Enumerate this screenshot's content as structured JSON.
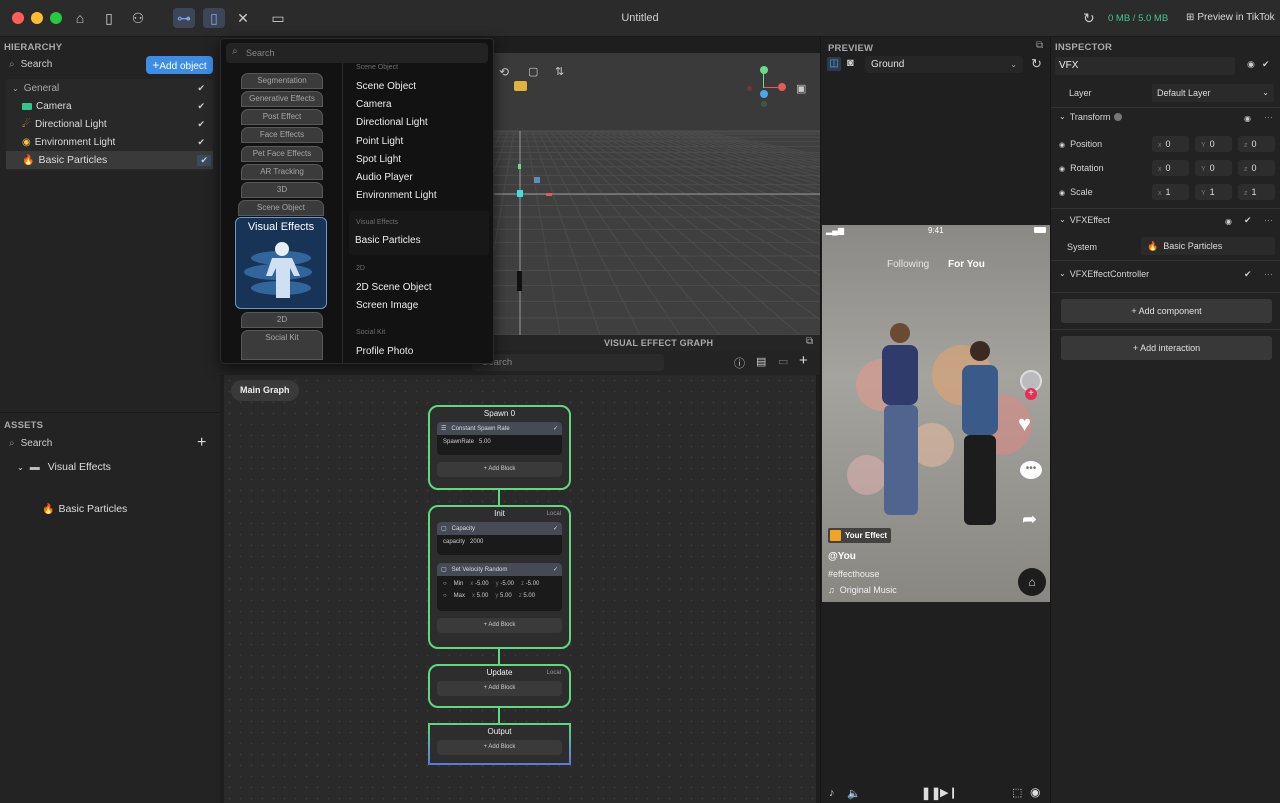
{
  "window": {
    "title": "Untitled",
    "storage": "0 MB / 5.0 MB",
    "preview_tiktok": "Preview in TikTok",
    "storage_color": "#3ec98b"
  },
  "toolbar": {
    "icons": [
      "home-icon",
      "book-icon",
      "nodes-icon",
      "graph-icon",
      "phone-icon",
      "tools-icon",
      "tablet-icon"
    ]
  },
  "hierarchy": {
    "title": "HIERARCHY",
    "search_placeholder": "Search",
    "add_object": "Add object",
    "items": [
      {
        "label": "General",
        "type": "group"
      },
      {
        "label": "Camera",
        "type": "camera"
      },
      {
        "label": "Directional Light",
        "type": "light"
      },
      {
        "label": "Environment Light",
        "type": "envlight"
      },
      {
        "label": "Basic Particles",
        "type": "particles",
        "selected": true
      }
    ]
  },
  "assets": {
    "title": "ASSETS",
    "search_placeholder": "Search",
    "items": [
      {
        "label": "Visual Effects",
        "type": "folder"
      },
      {
        "label": "Basic Particles",
        "type": "particles"
      }
    ]
  },
  "add_menu": {
    "search_placeholder": "Search",
    "categories": [
      "Segmentation",
      "Generative Effects",
      "Post Effect",
      "Face Effects",
      "Pet Face Effects",
      "AR Tracking",
      "3D",
      "Scene Object",
      "Visual Effects",
      "2D",
      "Social Kit"
    ],
    "selected_category": "Visual Effects",
    "sections": [
      {
        "title": "Scene Object",
        "items": [
          "Scene Object",
          "Camera",
          "Directional Light",
          "Point Light",
          "Spot Light",
          "Audio Player",
          "Environment Light"
        ]
      },
      {
        "title": "Visual Effects",
        "items": [
          "Basic Particles"
        ]
      },
      {
        "title": "2D",
        "items": [
          "2D Scene Object",
          "Screen Image"
        ]
      },
      {
        "title": "Social Kit",
        "items": [
          "Profile Photo"
        ]
      }
    ]
  },
  "graph": {
    "title": "VISUAL EFFECT GRAPH",
    "search_placeholder": "Search",
    "breadcrumb": "Main Graph",
    "nodes": {
      "spawn": {
        "title": "Spawn 0",
        "block": "Constant Spawn Rate",
        "field": "SpawnRate",
        "value": "5.00",
        "add": "+ Add Block"
      },
      "init": {
        "title": "Init",
        "space": "Local",
        "capacity": {
          "block": "Capacity",
          "field": "capacity",
          "value": "2000"
        },
        "velocity": {
          "block": "Set Velocity Random",
          "min": {
            "label": "Min",
            "x": "-5.00",
            "y": "-5.00",
            "z": "-5.00"
          },
          "max": {
            "label": "Max",
            "x": "5.00",
            "y": "5.00",
            "z": "5.00"
          }
        },
        "add": "+ Add Block"
      },
      "update": {
        "title": "Update",
        "space": "Local",
        "add": "+ Add Block"
      },
      "output": {
        "title": "Output",
        "add": "+ Add Block"
      }
    }
  },
  "preview": {
    "title": "PREVIEW",
    "environment": "Ground",
    "phone": {
      "time": "9:41",
      "tabs": [
        "Following",
        "For You"
      ],
      "effect_badge": "Your Effect",
      "user": "@You",
      "hashtag": "#effecthouse",
      "music": "Original Music"
    }
  },
  "inspector": {
    "title": "INSPECTOR",
    "name": "VFX",
    "layer_label": "Layer",
    "layer_value": "Default Layer",
    "transform": {
      "title": "Transform",
      "position": {
        "label": "Position",
        "x": "0",
        "y": "0",
        "z": "0"
      },
      "rotation": {
        "label": "Rotation",
        "x": "0",
        "y": "0",
        "z": "0"
      },
      "scale": {
        "label": "Scale",
        "x": "1",
        "y": "1",
        "z": "1"
      }
    },
    "vfx_effect": {
      "title": "VFXEffect",
      "system_label": "System",
      "system_value": "Basic Particles"
    },
    "vfx_controller": {
      "title": "VFXEffectController"
    },
    "add_component": "+ Add component",
    "add_interaction": "+ Add interaction"
  }
}
